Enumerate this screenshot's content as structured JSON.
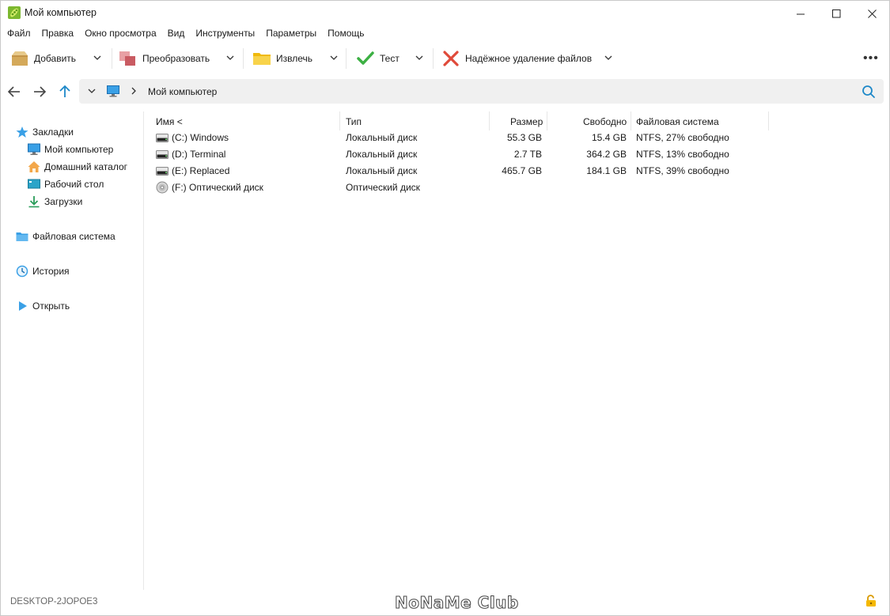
{
  "window": {
    "title": "Мой компьютер"
  },
  "menu": [
    "Файл",
    "Правка",
    "Окно просмотра",
    "Вид",
    "Инструменты",
    "Параметры",
    "Помощь"
  ],
  "toolbar": {
    "add_label": "Добавить",
    "convert_label": "Преобразовать",
    "extract_label": "Извлечь",
    "test_label": "Тест",
    "secure_delete_label": "Надёжное удаление файлов",
    "more_label": "•••"
  },
  "address": {
    "path": "Мой компьютер"
  },
  "sidebar": {
    "bookmarks_label": "Закладки",
    "bookmarks": [
      "Мой компьютер",
      "Домашний каталог",
      "Рабочий стол",
      "Загрузки"
    ],
    "filesystem_label": "Файловая система",
    "history_label": "История",
    "open_label": "Открыть"
  },
  "table": {
    "columns": [
      "Имя <",
      "Тип",
      "Размер",
      "Свободно",
      "Файловая система"
    ],
    "rows": [
      {
        "name": "(C:) Windows",
        "type": "Локальный диск",
        "size": "55.3 GB",
        "free": "15.4 GB",
        "fs": "NTFS, 27% свободно",
        "icon": "drive-icon"
      },
      {
        "name": "(D:) Terminal",
        "type": "Локальный диск",
        "size": "2.7 TB",
        "free": "364.2 GB",
        "fs": "NTFS, 13% свободно",
        "icon": "drive-icon"
      },
      {
        "name": "(E:) Replaced",
        "type": "Локальный диск",
        "size": "465.7 GB",
        "free": "184.1 GB",
        "fs": "NTFS, 39% свободно",
        "icon": "drive-icon"
      },
      {
        "name": "(F:) Оптический диск",
        "type": "Оптический диск",
        "size": "",
        "free": "",
        "fs": "",
        "icon": "optical-disc-icon"
      }
    ]
  },
  "status": {
    "host": "DESKTOP-2JOPOE3",
    "watermark": "NoNaMe Club"
  },
  "colors": {
    "accent": "#1e88c8",
    "folder": "#f5c518",
    "check": "#3cb043",
    "cross": "#e04a3a",
    "sidebar_icon": "#3aa0e6"
  }
}
